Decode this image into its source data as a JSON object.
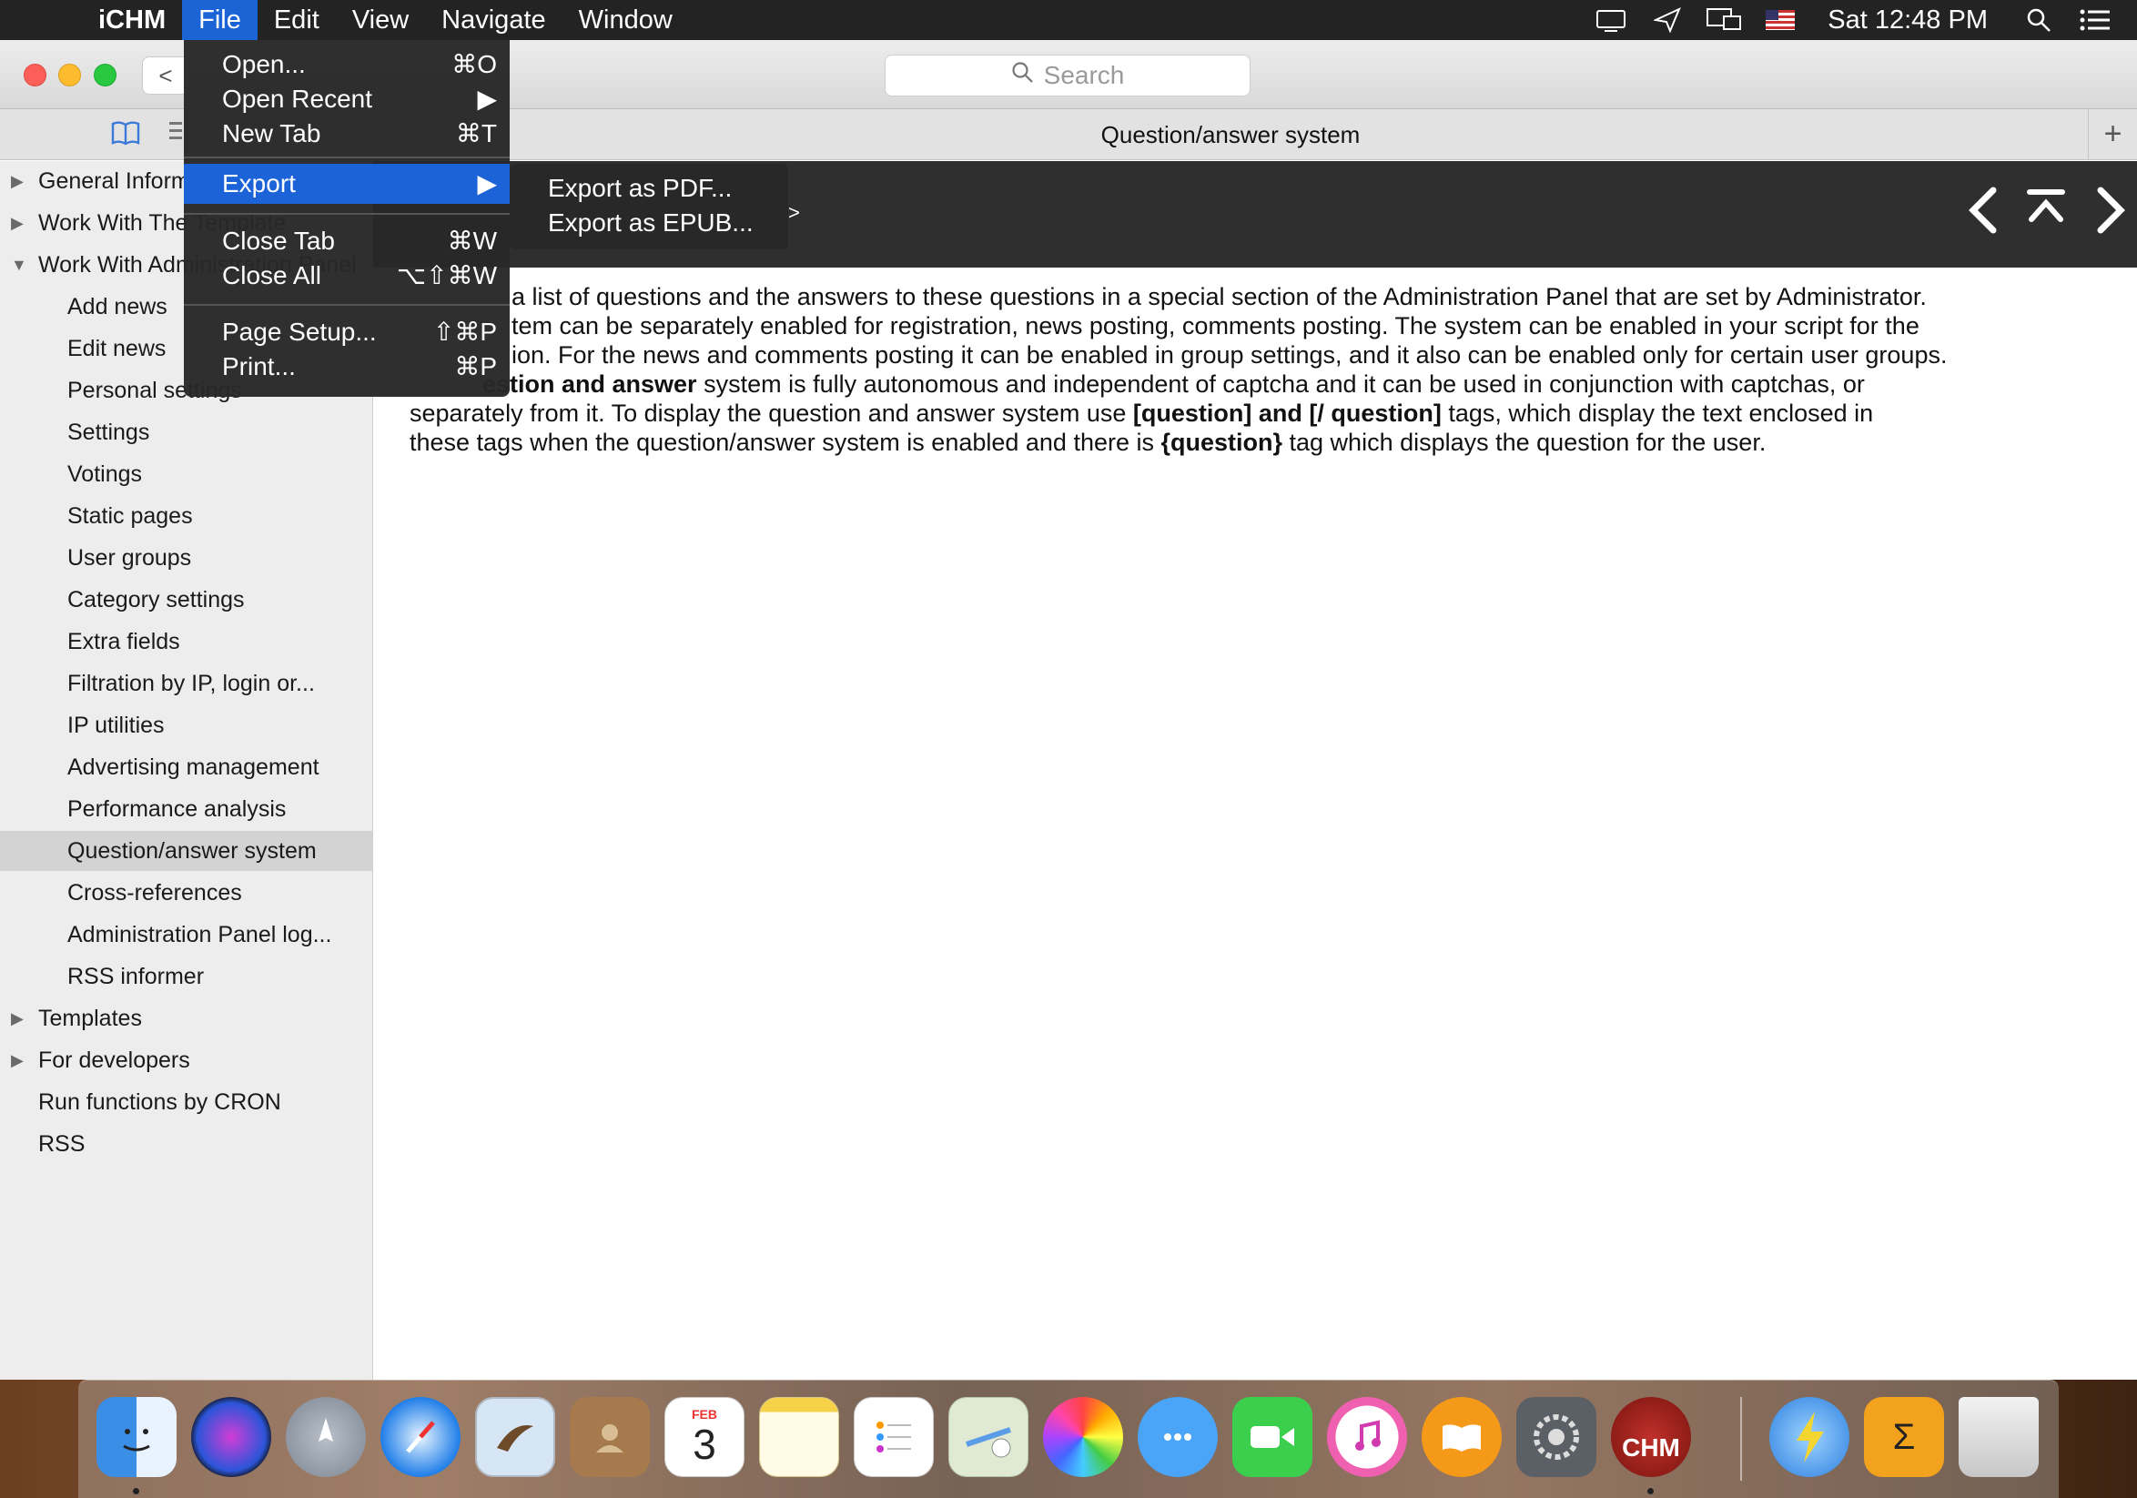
{
  "menubar": {
    "app_name": "iCHM",
    "menus": [
      "File",
      "Edit",
      "View",
      "Navigate",
      "Window"
    ],
    "active_menu": "File",
    "clock": "Sat 12:48 PM"
  },
  "toolbar": {
    "back_label": "<",
    "search_placeholder": "Search",
    "tab_title": "Question/answer system",
    "new_tab_label": "+"
  },
  "file_menu": {
    "items": [
      {
        "label": "Open...",
        "shortcut": "⌘O"
      },
      {
        "label": "Open Recent",
        "shortcut": "▶"
      },
      {
        "label": "New Tab",
        "shortcut": "⌘T"
      },
      {
        "label": "Export",
        "shortcut": "▶"
      },
      {
        "label": "Close Tab",
        "shortcut": "⌘W"
      },
      {
        "label": "Close All",
        "shortcut": "⌥⇧⌘W"
      },
      {
        "label": "Page Setup...",
        "shortcut": "⇧⌘P"
      },
      {
        "label": "Print...",
        "shortcut": "⌘P"
      }
    ],
    "highlighted": "Export"
  },
  "export_submenu": {
    "items": [
      "Export as PDF...",
      "Export as EPUB..."
    ]
  },
  "sidebar": {
    "items": [
      {
        "label": "General Information",
        "arrow": "▶"
      },
      {
        "label": "Work With The Template",
        "arrow": "▶"
      },
      {
        "label": "Work With Administration Panel",
        "arrow": "▼"
      },
      {
        "label": "Add news",
        "arrow": ""
      },
      {
        "label": "Edit news",
        "arrow": ""
      },
      {
        "label": "Personal settings",
        "arrow": ""
      },
      {
        "label": "Settings",
        "arrow": ""
      },
      {
        "label": "Votings",
        "arrow": ""
      },
      {
        "label": "Static pages",
        "arrow": ""
      },
      {
        "label": "User groups",
        "arrow": ""
      },
      {
        "label": "Category settings",
        "arrow": ""
      },
      {
        "label": "Extra fields",
        "arrow": ""
      },
      {
        "label": "Filtration by IP, login or...",
        "arrow": ""
      },
      {
        "label": "IP utilities",
        "arrow": ""
      },
      {
        "label": "Advertising management",
        "arrow": ""
      },
      {
        "label": "Performance analysis",
        "arrow": ""
      },
      {
        "label": "Question/answer system",
        "arrow": ""
      },
      {
        "label": "Cross-references",
        "arrow": ""
      },
      {
        "label": "Administration Panel log...",
        "arrow": ""
      },
      {
        "label": "RSS informer",
        "arrow": ""
      },
      {
        "label": "Templates",
        "arrow": "▶"
      },
      {
        "label": "For developers",
        "arrow": "▶"
      },
      {
        "label": "Run functions by CRON",
        "arrow": ""
      },
      {
        "label": "RSS",
        "arrow": ""
      }
    ],
    "selected": "Question/answer system"
  },
  "header": {
    "breadcrumb_arrow": ">"
  },
  "content": {
    "l1": "a list of questions and the answers to these questions in a special section of the Administration Panel that are set by Administrator.",
    "l2": "tem can be separately enabled for registration, news posting, comments posting. The system can be enabled in your script for the",
    "l3": "ion. For the news and comments posting it can be enabled in group settings, and it also can be enabled only for certain user groups.",
    "l4_bold": "estion and answer",
    "l4_rest": " system is fully autonomous and independent of captcha and it can be used in conjunction with captchas, or",
    "l5_a": "separately from it. To display the question and answer system use ",
    "l5_b": "[question] and [/ question]",
    "l5_c": " tags, which display the text enclosed in",
    "l6_a": "these tags when the question/answer system is enabled and there is ",
    "l6_b": "{question}",
    "l6_c": " tag which displays the question for the user."
  },
  "dock": {
    "calendar_month": "FEB",
    "calendar_day": "3",
    "chm_label": "CHM",
    "sigma_label": "Σ"
  },
  "colors": {
    "accent": "#1c63d8",
    "header_band": "#2f2f2f",
    "sidebar_bg": "#ededed",
    "selected_row": "#d3d3d3"
  }
}
